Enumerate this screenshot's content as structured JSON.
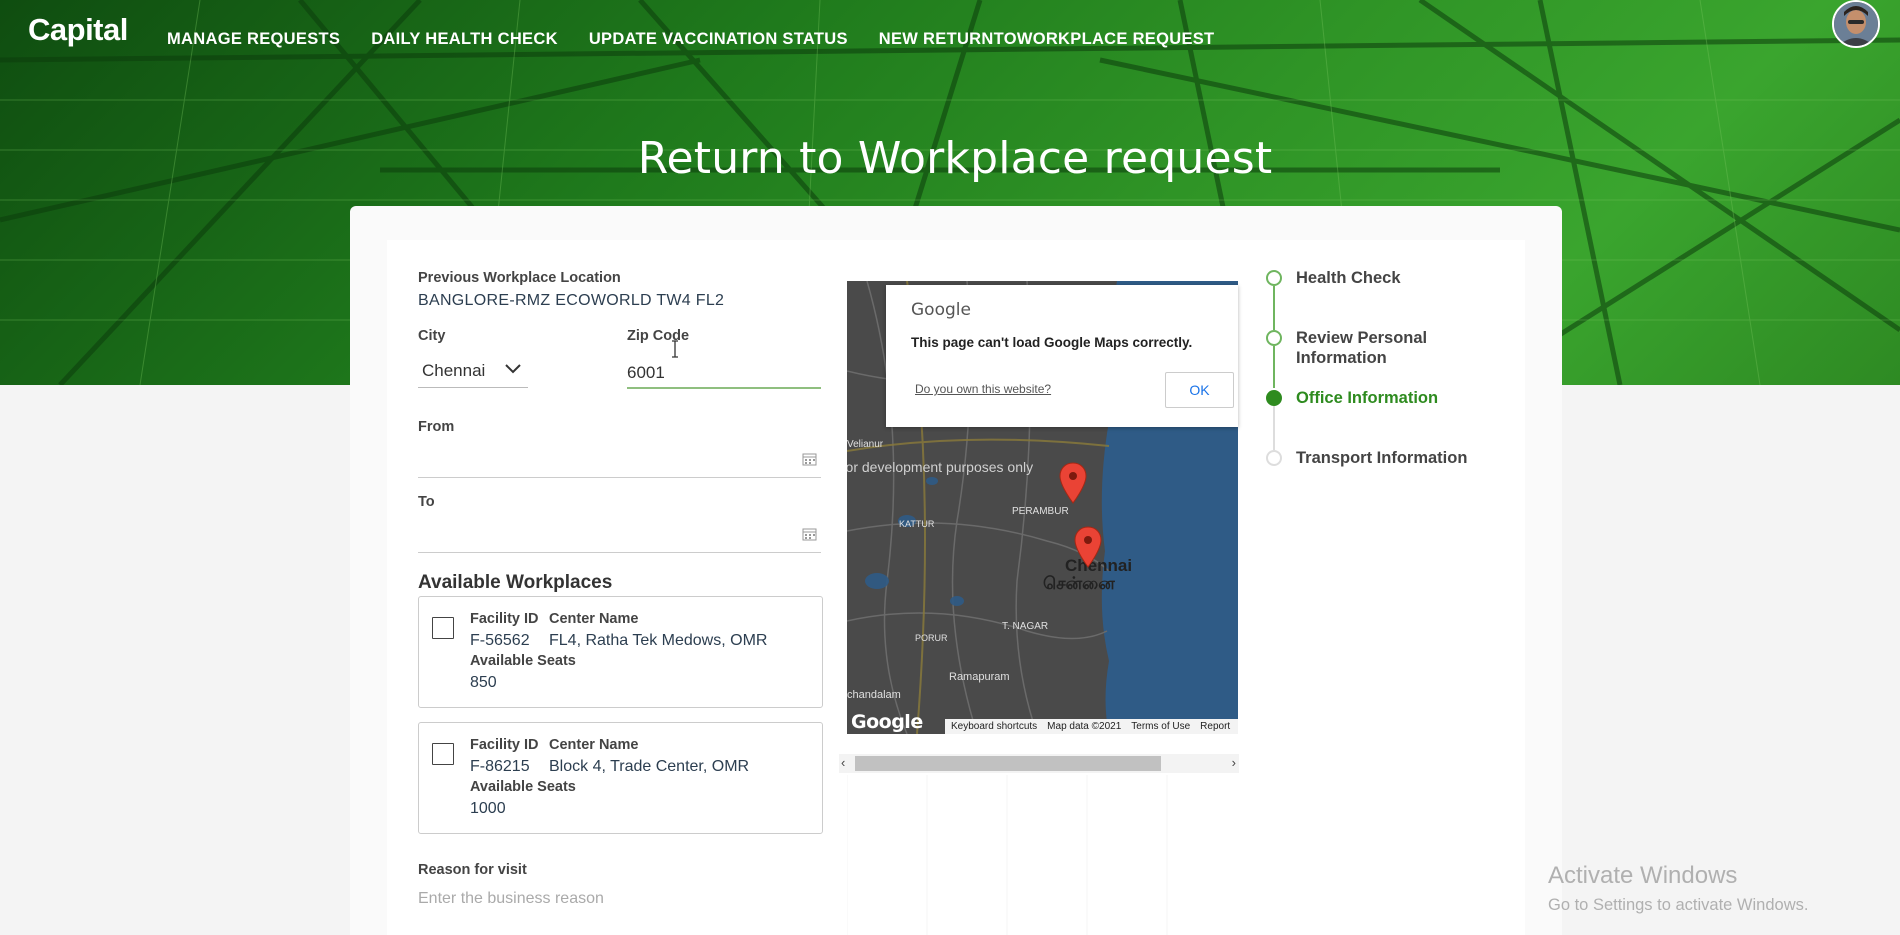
{
  "brand": {
    "logo": "Capital"
  },
  "nav": {
    "items": [
      {
        "label": "MANAGE REQUESTS"
      },
      {
        "label": "DAILY HEALTH CHECK"
      },
      {
        "label": "UPDATE VACCINATION STATUS"
      },
      {
        "label": "NEW RETURNTOWORKPLACE REQUEST"
      }
    ]
  },
  "page": {
    "title": "Return to Workplace request"
  },
  "form": {
    "previous_location": {
      "label": "Previous Workplace Location",
      "value": "BANGLORE-RMZ ECOWORLD TW4 FL2"
    },
    "city": {
      "label": "City",
      "value": "Chennai"
    },
    "zip": {
      "label": "Zip Code",
      "value": "6001"
    },
    "from": {
      "label": "From",
      "value": ""
    },
    "to": {
      "label": "To",
      "value": ""
    },
    "reason": {
      "label": "Reason for visit",
      "placeholder": "Enter the business reason"
    }
  },
  "workplaces": {
    "title": "Available Workplaces",
    "facility_label": "Facility ID",
    "center_label": "Center Name",
    "seats_label": "Available Seats",
    "items": [
      {
        "facility_id": "F-56562",
        "center_name": "FL4, Ratha Tek Medows, OMR",
        "seats": "850",
        "checked": false
      },
      {
        "facility_id": "F-86215",
        "center_name": "Block 4, Trade Center, OMR",
        "seats": "1000",
        "checked": false
      }
    ]
  },
  "map": {
    "dialog": {
      "brand": "Google",
      "message": "This page can't load Google Maps correctly.",
      "link": "Do you own this website?",
      "ok": "OK"
    },
    "watermark": "For development purposes only",
    "city_label": "Chennai",
    "city_label_ta": "சென்னை",
    "places": [
      "PERAMBUR",
      "T. NAGAR",
      "Ramapuram",
      "KATTUR",
      "PORUR",
      "Velianur",
      "chandalam"
    ],
    "footer": {
      "shortcuts": "Keyboard shortcuts",
      "data": "Map data ©2021",
      "terms": "Terms of Use",
      "report": "Report"
    },
    "logo": "Google"
  },
  "steps": {
    "items": [
      {
        "label": "Health Check",
        "state": "done"
      },
      {
        "label": "Review Personal Information",
        "state": "done"
      },
      {
        "label": "Office Information",
        "state": "active"
      },
      {
        "label": "Transport Information",
        "state": "pending"
      }
    ],
    "colors": {
      "active": "#2e8b1f",
      "done": "#6fb55f",
      "pending": "#dddddd"
    }
  },
  "windows_watermark": {
    "line1": "Activate Windows",
    "line2": "Go to Settings to activate Windows."
  }
}
